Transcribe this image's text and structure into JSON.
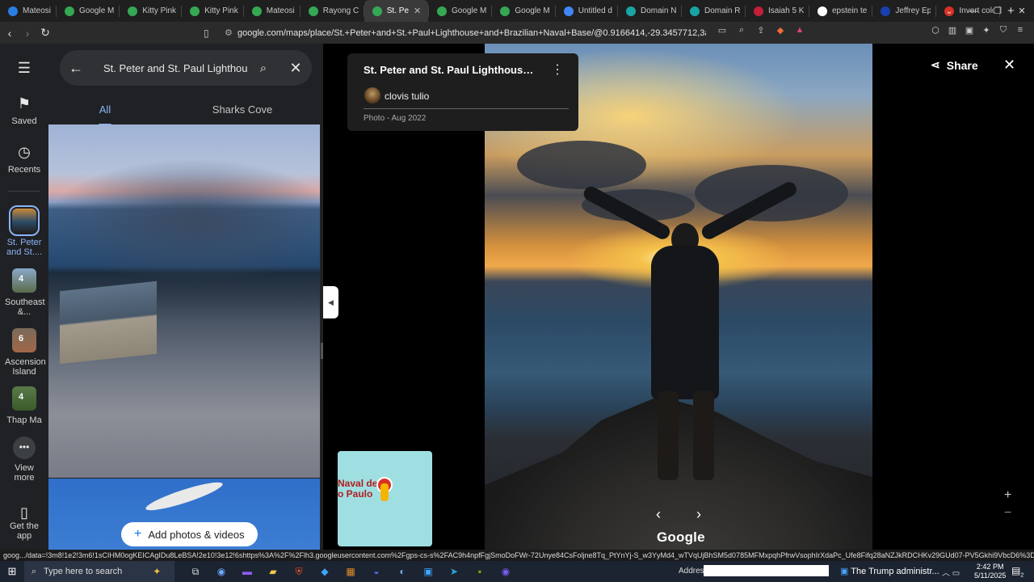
{
  "browser": {
    "tabs": [
      {
        "label": "Mateosi",
        "color": "#2a7de1",
        "icon": "map-pin-icon"
      },
      {
        "label": "Google M",
        "color": "#34a853",
        "icon": "map-pin-icon"
      },
      {
        "label": "Kitty Pink",
        "color": "#34a853",
        "icon": "map-pin-icon"
      },
      {
        "label": "Kitty Pink",
        "color": "#34a853",
        "icon": "map-pin-icon"
      },
      {
        "label": "Mateosi",
        "color": "#34a853",
        "icon": "map-pin-icon"
      },
      {
        "label": "Rayong C",
        "color": "#34a853",
        "icon": "map-pin-icon"
      },
      {
        "label": "St. Pe",
        "color": "#34a853",
        "icon": "map-pin-icon"
      },
      {
        "label": "Google M",
        "color": "#34a853",
        "icon": "map-pin-icon"
      },
      {
        "label": "Google M",
        "color": "#34a853",
        "icon": "map-pin-icon"
      },
      {
        "label": "Untitled d",
        "color": "#4285f4",
        "icon": "doc-icon"
      },
      {
        "label": "Domain N",
        "color": "#1aa3a3",
        "icon": "globe-icon"
      },
      {
        "label": "Domain R",
        "color": "#1aa3a3",
        "icon": "globe-icon"
      },
      {
        "label": "Isaiah 5 K",
        "color": "#c41e3a",
        "icon": "book-icon"
      },
      {
        "label": "epstein te",
        "color": "#ffffff",
        "icon": "google-icon"
      },
      {
        "label": "Jeffrey Ep",
        "color": "#1a3fb0",
        "icon": "bi-icon"
      },
      {
        "label": "Invert colo",
        "color": "#d93025",
        "icon": "pdf-icon"
      }
    ],
    "active_tab_index": 6,
    "new_tab": "+",
    "url": "google.com/maps/place/St.+Peter+and+St.+Paul+Lighthouse+and+Brazilian+Naval+Base/@0.9166414,-29.3457712,3a,75y/data=!3m8!1...",
    "status_url": "goog.../data=!3m8!1e2!3m6!1sCIHM0ogKEICAgIDu8LeBSA!2e10!3e12!6shttps%3A%2F%2Flh3.googleusercontent.com%2Fgps-cs-s%2FAC9h4npfFgjSmoDoFWr-72Unye84CsFoljne8Tq_PtYnYj-S_w3YyMd4_wTVqUjBhSM5d0785MFMxpqhPfrwVsophIrXdaPc_Ufe8Fifq28aNZJkRDCHKv29GUd07-PV5Gkhi9VbcD6%3Dw203-h270-k-no!7i1200!8i1600!4m9!3m..."
  },
  "maps": {
    "rail": {
      "menu_icon": "menu-icon",
      "saved": "Saved",
      "recents": "Recents",
      "places": [
        {
          "label": "St. Peter and St....",
          "count": ""
        },
        {
          "label": "Southeast &...",
          "count": "4"
        },
        {
          "label": "Ascension Island",
          "count": "6"
        },
        {
          "label": "Thap Ma",
          "count": "4"
        }
      ],
      "view_more": "View more",
      "get_app": "Get the app"
    },
    "search": {
      "value": "St. Peter and St. Paul Lighthouse and Brazilian Naval Base"
    },
    "tabs": [
      "All",
      "Sharks Cove"
    ],
    "add_photos_label": "Add photos & videos"
  },
  "viewer": {
    "title": "St. Peter and St. Paul Lighthouse an...",
    "author": "clovis tulio",
    "date": "Photo - Aug 2022",
    "share_label": "Share",
    "minimap_label": "Naval de\no Paulo",
    "wordmark": "Google"
  },
  "taskbar": {
    "search_placeholder": "Type here to search",
    "address_label": "Address",
    "news": "The Trump administr...",
    "time": "2:42 PM",
    "date": "5/11/2025",
    "notifications": "2"
  }
}
